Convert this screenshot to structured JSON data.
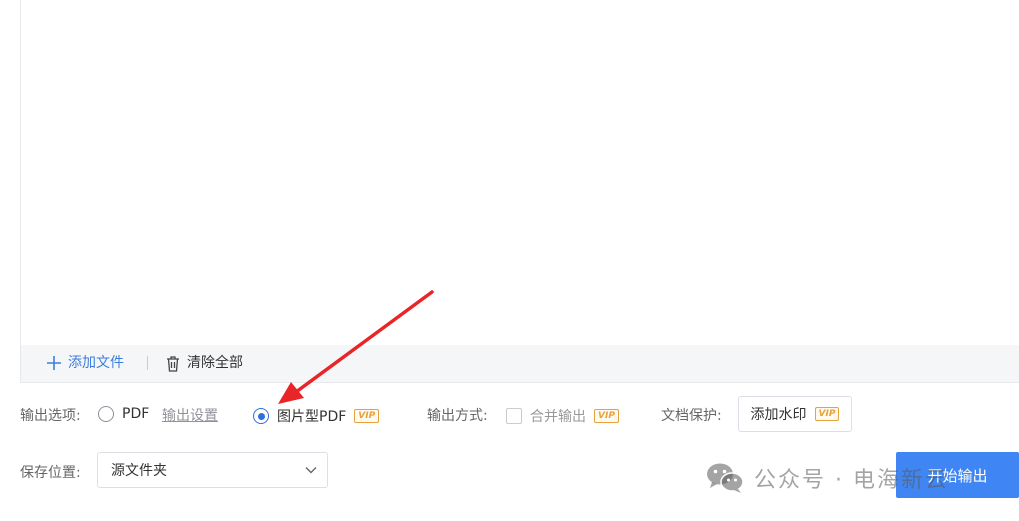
{
  "file_toolbar": {
    "add_label": "添加文件",
    "clear_label": "清除全部"
  },
  "output_options": {
    "label": "输出选项:",
    "pdf_label": "PDF",
    "settings_link": "输出设置",
    "image_pdf_label": "图片型PDF",
    "image_pdf_vip": "VIP",
    "selected": "图片型PDF"
  },
  "output_mode": {
    "label": "输出方式:",
    "merge_label": "合并输出",
    "merge_vip": "VIP",
    "merge_checked": false
  },
  "doc_protect": {
    "label": "文档保护:",
    "watermark_label": "添加水印",
    "watermark_vip": "VIP"
  },
  "save_location": {
    "label": "保存位置:",
    "value": "源文件夹"
  },
  "start_button": "开始输出",
  "watermark_overlay": {
    "text": "公众号 · 电海新云"
  },
  "colors": {
    "accent": "#3f86f4",
    "link": "#3d7ddc",
    "vip": "#e6a23c",
    "arrow": "#e8262a"
  }
}
